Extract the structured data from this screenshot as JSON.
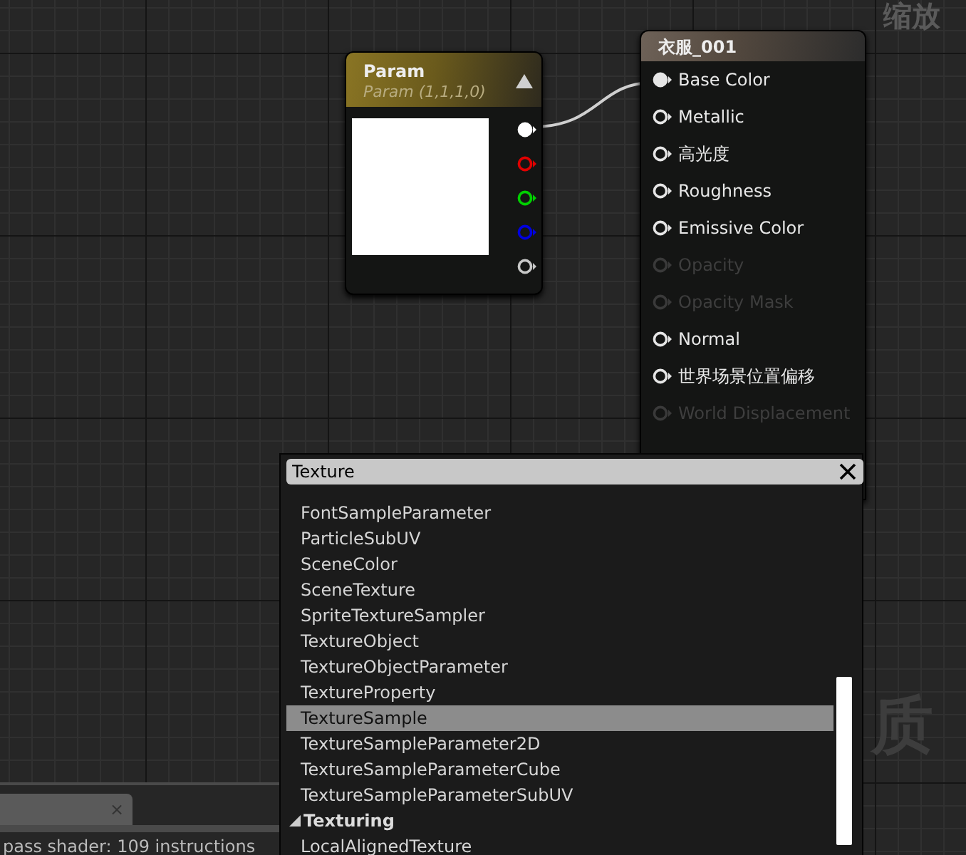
{
  "zoom_label": "缩放",
  "graph_watermark": "质",
  "param_node": {
    "title": "Param",
    "subtitle": "Param (1,1,1,0)",
    "expanded": true,
    "outputs": [
      {
        "color": "#ffffff",
        "connected": true
      },
      {
        "color": "#e00000",
        "connected": false
      },
      {
        "color": "#00d000",
        "connected": false
      },
      {
        "color": "#0000e0",
        "connected": false
      },
      {
        "color": "#c8c8c8",
        "connected": false
      }
    ]
  },
  "material_node": {
    "title": "衣服_001",
    "inputs": [
      {
        "label": "Base Color",
        "enabled": true,
        "connected": true
      },
      {
        "label": "Metallic",
        "enabled": true,
        "connected": false
      },
      {
        "label": "高光度",
        "enabled": true,
        "connected": false
      },
      {
        "label": "Roughness",
        "enabled": true,
        "connected": false
      },
      {
        "label": "Emissive Color",
        "enabled": true,
        "connected": false
      },
      {
        "label": "Opacity",
        "enabled": false,
        "connected": false
      },
      {
        "label": "Opacity Mask",
        "enabled": false,
        "connected": false
      },
      {
        "label": "Normal",
        "enabled": true,
        "connected": false
      },
      {
        "label": "世界场景位置偏移",
        "enabled": true,
        "connected": false
      },
      {
        "label": "World Displacement",
        "enabled": false,
        "connected": false
      }
    ]
  },
  "palette": {
    "search": {
      "value": "Texture"
    },
    "items": [
      {
        "kind": "item",
        "label": "FontSampleParameter",
        "selected": false
      },
      {
        "kind": "item",
        "label": "ParticleSubUV",
        "selected": false
      },
      {
        "kind": "item",
        "label": "SceneColor",
        "selected": false
      },
      {
        "kind": "item",
        "label": "SceneTexture",
        "selected": false
      },
      {
        "kind": "item",
        "label": "SpriteTextureSampler",
        "selected": false
      },
      {
        "kind": "item",
        "label": "TextureObject",
        "selected": false
      },
      {
        "kind": "item",
        "label": "TextureObjectParameter",
        "selected": false
      },
      {
        "kind": "item",
        "label": "TextureProperty",
        "selected": false
      },
      {
        "kind": "item",
        "label": "TextureSample",
        "selected": true
      },
      {
        "kind": "item",
        "label": "TextureSampleParameter2D",
        "selected": false
      },
      {
        "kind": "item",
        "label": "TextureSampleParameterCube",
        "selected": false
      },
      {
        "kind": "item",
        "label": "TextureSampleParameterSubUV",
        "selected": false
      },
      {
        "kind": "category",
        "label": "Texturing",
        "selected": false
      },
      {
        "kind": "item",
        "label": "LocalAlignedTexture",
        "selected": false
      }
    ]
  },
  "bottom_panel": {
    "tab": {
      "close": "×"
    },
    "status": "pass shader: 109 instructions"
  }
}
